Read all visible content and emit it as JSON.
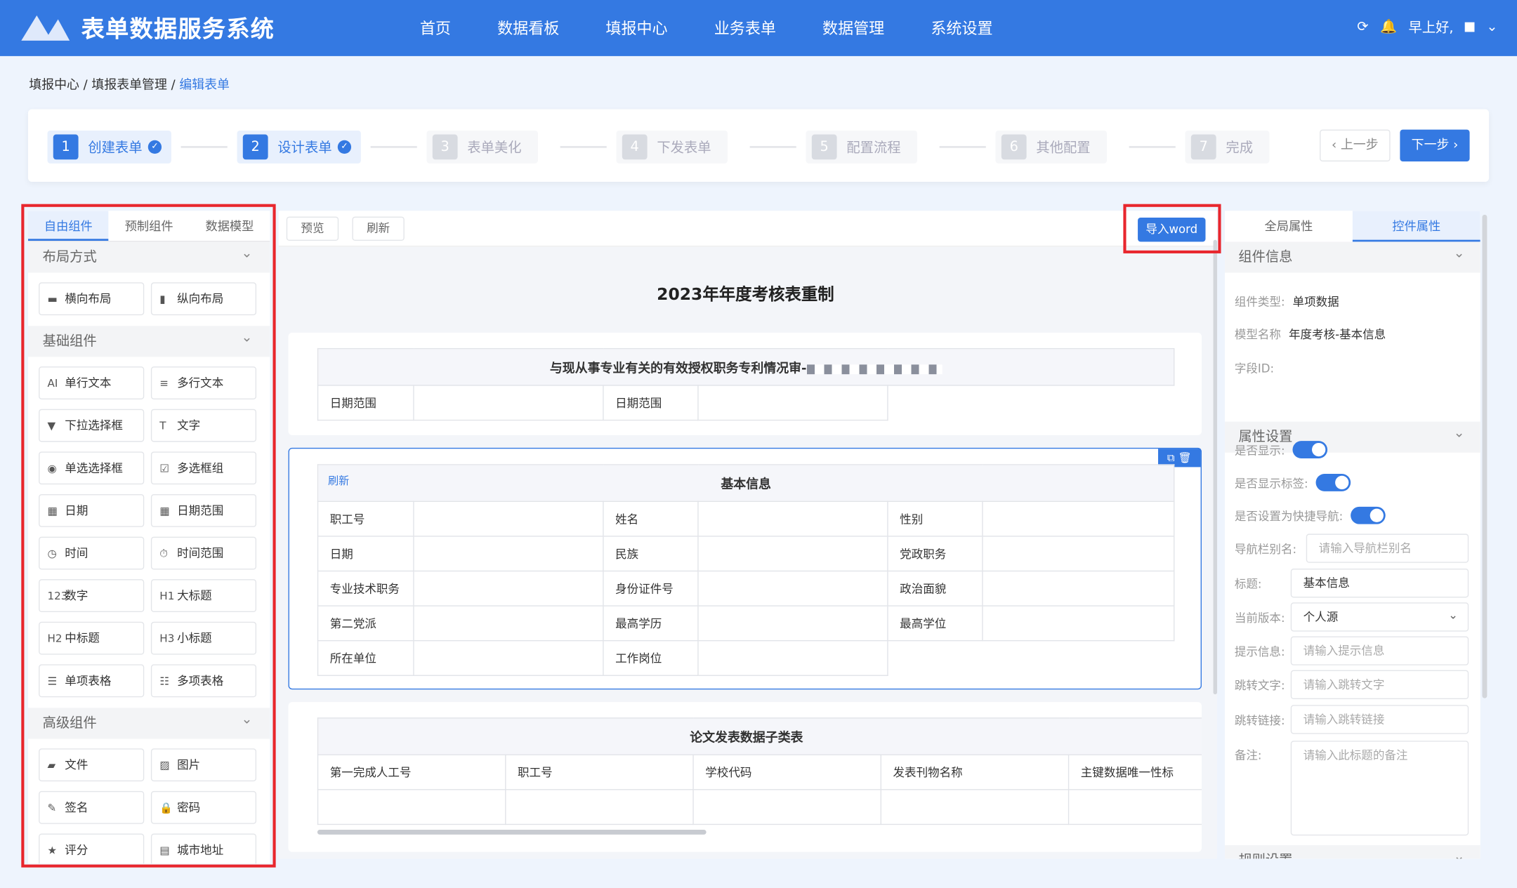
{
  "header": {
    "app_title": "表单数据服务系统",
    "nav": [
      "首页",
      "数据看板",
      "填报中心",
      "业务表单",
      "数据管理",
      "系统设置"
    ],
    "greeting": "早上好,"
  },
  "breadcrumb": [
    "填报中心",
    "填报表单管理",
    "编辑表单"
  ],
  "steps": [
    {
      "num": "1",
      "label": "创建表单",
      "status": "done"
    },
    {
      "num": "2",
      "label": "设计表单",
      "status": "done"
    },
    {
      "num": "3",
      "label": "表单美化",
      "status": "todo"
    },
    {
      "num": "4",
      "label": "下发表单",
      "status": "todo"
    },
    {
      "num": "5",
      "label": "配置流程",
      "status": "todo"
    },
    {
      "num": "6",
      "label": "其他配置",
      "status": "todo"
    },
    {
      "num": "7",
      "label": "完成",
      "status": "todo"
    }
  ],
  "step_nav": {
    "prev": "‹ 上一步",
    "next": "下一步 ›"
  },
  "left": {
    "tabs": [
      "自由组件",
      "预制组件",
      "数据模型"
    ],
    "sections": [
      {
        "title": "布局方式",
        "items": [
          {
            "icon": "▬",
            "label": "横向布局"
          },
          {
            "icon": "▮",
            "label": "纵向布局"
          }
        ]
      },
      {
        "title": "基础组件",
        "items": [
          {
            "icon": "AI",
            "label": "单行文本"
          },
          {
            "icon": "≡",
            "label": "多行文本"
          },
          {
            "icon": "▼",
            "label": "下拉选择框"
          },
          {
            "icon": "T",
            "label": "文字"
          },
          {
            "icon": "◉",
            "label": "单选选择框"
          },
          {
            "icon": "☑",
            "label": "多选框组"
          },
          {
            "icon": "▦",
            "label": "日期"
          },
          {
            "icon": "▦",
            "label": "日期范围"
          },
          {
            "icon": "◷",
            "label": "时间"
          },
          {
            "icon": "⏱",
            "label": "时间范围"
          },
          {
            "icon": "123",
            "label": "数字"
          },
          {
            "icon": "H1",
            "label": "大标题"
          },
          {
            "icon": "H2",
            "label": "中标题"
          },
          {
            "icon": "H3",
            "label": "小标题"
          },
          {
            "icon": "☰",
            "label": "单项表格"
          },
          {
            "icon": "☷",
            "label": "多项表格"
          }
        ]
      },
      {
        "title": "高级组件",
        "items": [
          {
            "icon": "▰",
            "label": "文件"
          },
          {
            "icon": "▨",
            "label": "图片"
          },
          {
            "icon": "✎",
            "label": "签名"
          },
          {
            "icon": "🔒",
            "label": "密码"
          },
          {
            "icon": "★",
            "label": "评分"
          },
          {
            "icon": "▤",
            "label": "城市地址"
          }
        ]
      }
    ]
  },
  "canvas": {
    "toolbar": {
      "preview": "预览",
      "refresh": "刷新",
      "import_word": "导入word"
    },
    "form_title": "2023年年度考核表重制",
    "card1": {
      "title": "与现从事专业有关的有效授权职务专利情况审-",
      "labels": [
        "日期范围",
        "日期范围"
      ]
    },
    "card2": {
      "refresh": "刷新",
      "title": "基本信息",
      "rows": [
        [
          "职工号",
          "姓名",
          "性别"
        ],
        [
          "日期",
          "民族",
          "党政职务"
        ],
        [
          "专业技术职务",
          "身份证件号",
          "政治面貌"
        ],
        [
          "第二党派",
          "最高学历",
          "最高学位"
        ],
        [
          "所在单位",
          "工作岗位"
        ]
      ]
    },
    "card3": {
      "title": "论文发表数据子类表",
      "columns": [
        "第一完成人工号",
        "职工号",
        "学校代码",
        "发表刊物名称",
        "主键数据唯一性标"
      ]
    }
  },
  "right": {
    "tabs": [
      "全局属性",
      "控件属性"
    ],
    "info": {
      "title": "组件信息",
      "type_label": "组件类型:",
      "type_value": "单项数据",
      "model_label": "模型名称",
      "model_value": "年度考核-基本信息",
      "field_label": "字段ID:"
    },
    "props": {
      "title": "属性设置",
      "show": "是否显示:",
      "show_label": "是否显示标签:",
      "quick_nav": "是否设置为快捷导航:",
      "nav_alias": "导航栏别名:",
      "nav_alias_ph": "请输入导航栏别名",
      "title_label": "标题:",
      "title_value": "基本信息",
      "version_label": "当前版本:",
      "version_value": "个人源",
      "hint_label": "提示信息:",
      "hint_ph": "请输入提示信息",
      "jump_text": "跳转文字:",
      "jump_text_ph": "请输入跳转文字",
      "jump_link": "跳转链接:",
      "jump_link_ph": "请输入跳转链接",
      "remark": "备注:",
      "remark_ph": "请输入此标题的备注"
    },
    "rules": {
      "title": "规则设置"
    }
  },
  "colors": {
    "primary": "#3479e2",
    "highlight": "#e8262d"
  }
}
